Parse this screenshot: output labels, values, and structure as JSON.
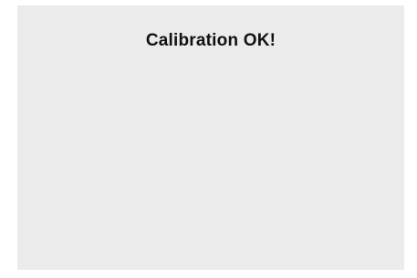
{
  "screen": {
    "message": "Calibration OK!",
    "background_color": "#ebebeb"
  }
}
